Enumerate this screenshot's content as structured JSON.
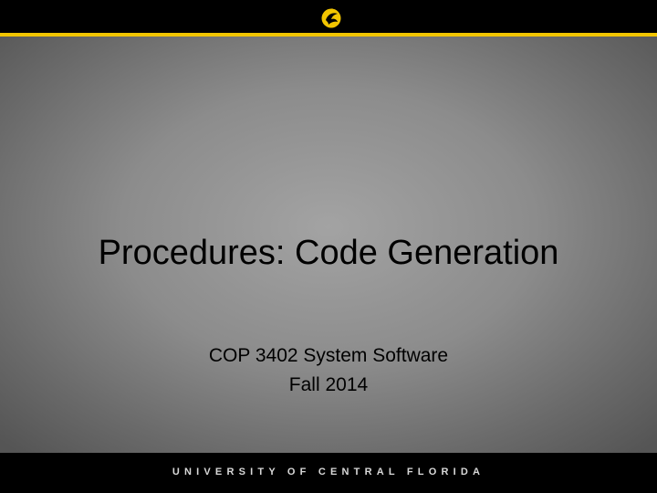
{
  "header": {
    "logo_icon": "pegasus-icon",
    "accent_color": "#f2c500"
  },
  "title": "Procedures: Code Generation",
  "subtitle": {
    "line1": "COP 3402 System Software",
    "line2": "Fall 2014"
  },
  "footer": {
    "wordmark": "UNIVERSITY OF CENTRAL FLORIDA"
  }
}
